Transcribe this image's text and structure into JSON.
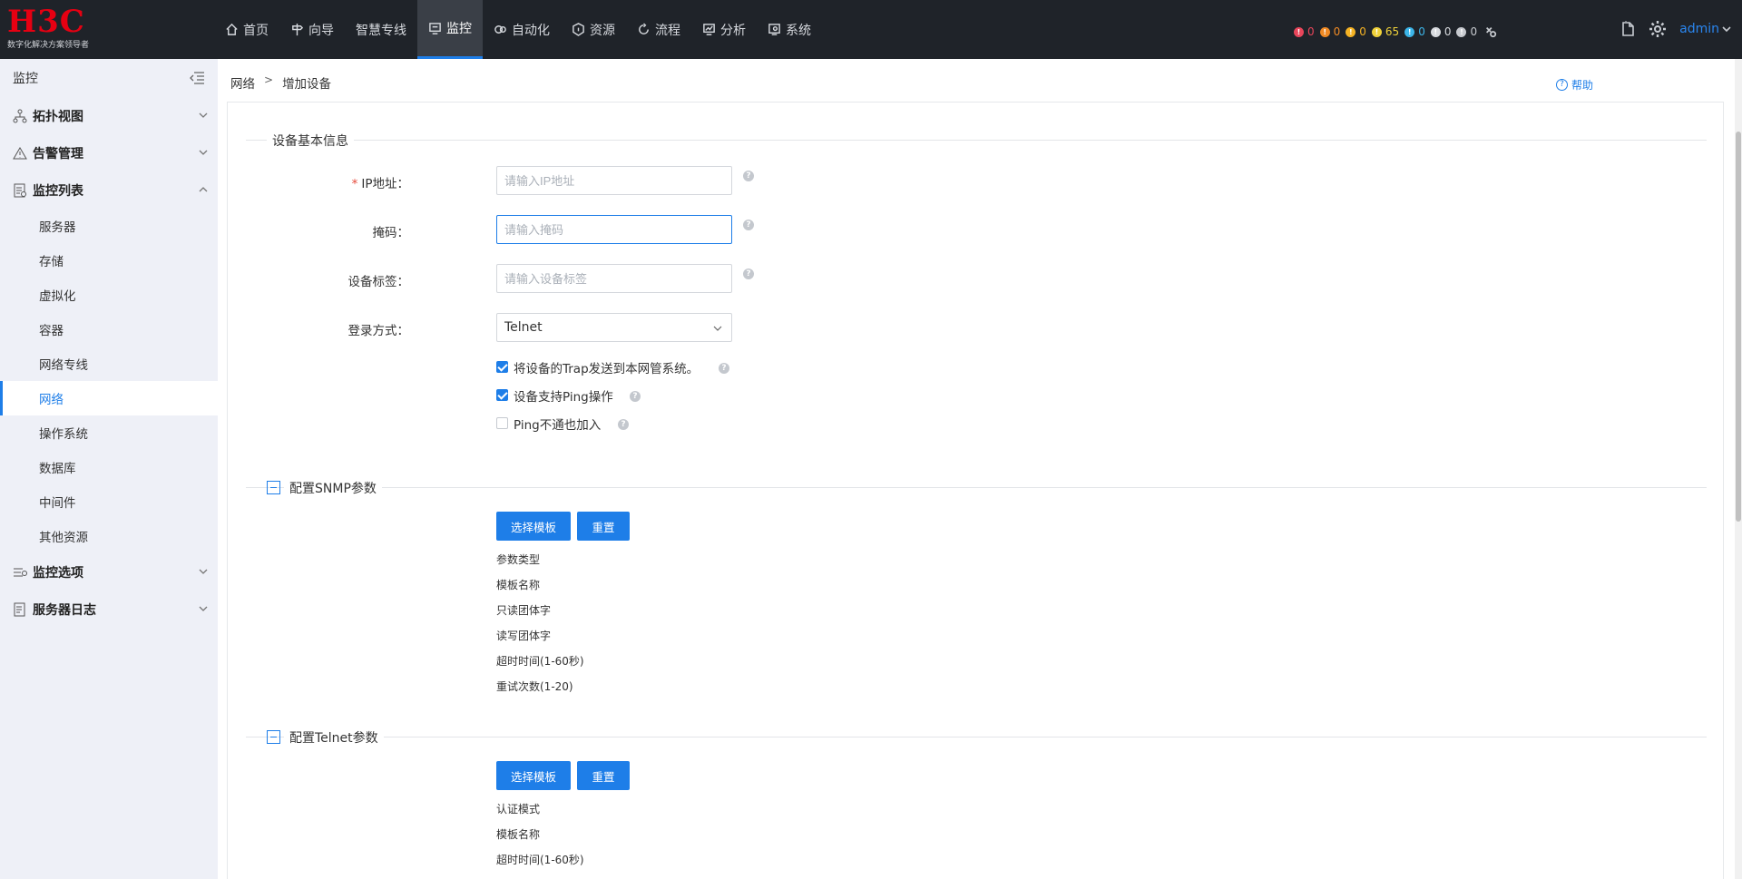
{
  "brand": {
    "logo": "H3C",
    "tagline": "数字化解决方案领导者"
  },
  "nav": {
    "items": [
      {
        "label": "首页",
        "icon": "home-icon"
      },
      {
        "label": "向导",
        "icon": "signpost-icon"
      },
      {
        "label": "智慧专线",
        "icon": ""
      },
      {
        "label": "监控",
        "icon": "monitor-icon",
        "active": true
      },
      {
        "label": "自动化",
        "icon": "automation-icon"
      },
      {
        "label": "资源",
        "icon": "resource-icon"
      },
      {
        "label": "流程",
        "icon": "flow-icon"
      },
      {
        "label": "分析",
        "icon": "analysis-icon"
      },
      {
        "label": "系统",
        "icon": "system-icon"
      }
    ]
  },
  "alarms": [
    {
      "count": "0",
      "color": "#e8455a"
    },
    {
      "count": "0",
      "color": "#f08a24"
    },
    {
      "count": "0",
      "color": "#f5b324"
    },
    {
      "count": "65",
      "color": "#f0d23a"
    },
    {
      "count": "0",
      "color": "#3cb5e8"
    },
    {
      "count": "0",
      "color": "#d7dade"
    },
    {
      "count": "0",
      "color": "#c6c9ce"
    }
  ],
  "user": {
    "name": "admin"
  },
  "sidebar": {
    "title": "监控",
    "groups": [
      {
        "label": "拓扑视图",
        "expanded": false
      },
      {
        "label": "告警管理",
        "expanded": false
      },
      {
        "label": "监控列表",
        "expanded": true
      }
    ],
    "subitems": [
      "服务器",
      "存储",
      "虚拟化",
      "容器",
      "网络专线",
      "网络",
      "操作系统",
      "数据库",
      "中间件",
      "其他资源"
    ],
    "active_subitem": "网络",
    "groups_after": [
      {
        "label": "监控选项",
        "expanded": false
      },
      {
        "label": "服务器日志",
        "expanded": false
      }
    ]
  },
  "breadcrumb": {
    "parent": "网络",
    "separator": ">",
    "current": "增加设备"
  },
  "help_label": "帮助",
  "basic": {
    "title": "设备基本信息",
    "ip_label": "IP地址：",
    "ip_placeholder": "请输入IP地址",
    "mask_label": "掩码：",
    "mask_placeholder": "请输入掩码",
    "tag_label": "设备标签：",
    "tag_placeholder": "请输入设备标签",
    "login_label": "登录方式：",
    "login_value": "Telnet",
    "opt_trap": "将设备的Trap发送到本网管系统。",
    "opt_trap_checked": true,
    "opt_ping": "设备支持Ping操作",
    "opt_ping_checked": true,
    "opt_pingfail": "Ping不通也加入",
    "opt_pingfail_checked": false
  },
  "snmp": {
    "title": "配置SNMP参数",
    "select_template": "选择模板",
    "reset": "重置",
    "params": [
      "参数类型",
      "模板名称",
      "只读团体字",
      "读写团体字",
      "超时时间(1-60秒)",
      "重试次数(1-20)"
    ]
  },
  "telnet": {
    "title": "配置Telnet参数",
    "select_template": "选择模板",
    "reset": "重置",
    "params": [
      "认证模式",
      "模板名称",
      "超时时间(1-60秒)"
    ]
  }
}
